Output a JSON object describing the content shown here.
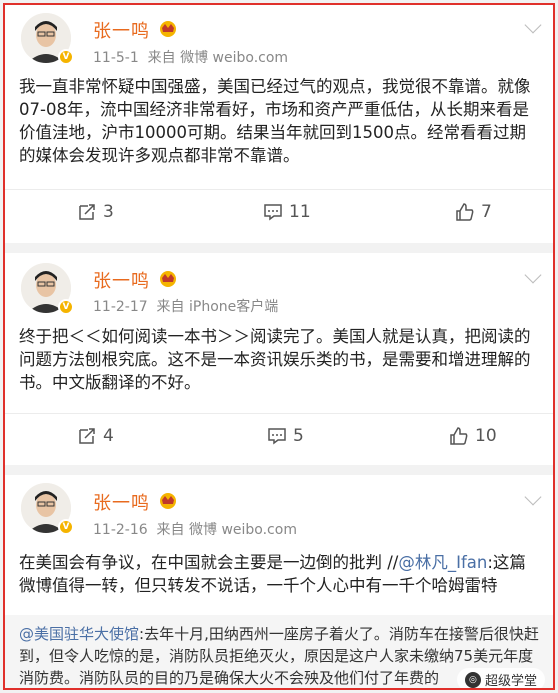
{
  "posts": [
    {
      "author": "张一鸣",
      "date": "11-5-1",
      "source": "来自 微博 weibo.com",
      "text": "我一直非常怀疑中国强盛，美国已经过气的观点，我觉很不靠谱。就像07-08年，流中国经济非常看好，市场和资产严重低估，从长期来看是价值洼地，沪市10000可期。结果当年就回到1500点。经常看看过期的媒体会发现许多观点都非常不靠谱。",
      "reposts": "3",
      "comments": "11",
      "likes": "7"
    },
    {
      "author": "张一鸣",
      "date": "11-2-17",
      "source": "来自 iPhone客户端",
      "text": "终于把＜＜如何阅读一本书＞＞阅读完了。美国人就是认真，把阅读的问题方法刨根究底。这不是一本资讯娱乐类的书，是需要和增进理解的书。中文版翻译的不好。",
      "reposts": "4",
      "comments": "5",
      "likes": "10"
    },
    {
      "author": "张一鸣",
      "date": "11-2-16",
      "source": "来自 微博 weibo.com",
      "text_before": "在美国会有争议，在中国就会主要是一边倒的批判 //",
      "mention": "@林凡_Ifan",
      "text_after": ":这篇微博值得一转，但只转发不说话，一千个人心中有一千个哈姆雷特",
      "repost_mention": "@美国驻华大使馆",
      "repost_text": ":去年十月,田纳西州一座房子着火了。消防车在接警后很快赶到，但令人吃惊的是，消防队员拒绝灭火，原因是这户人家未缴纳75美元年度消防费。消防队员的目的乃是确保大火不会殃及他们付了年费的"
    }
  ],
  "watermark": "超级学堂",
  "colors": {
    "frame": "#e0302b",
    "name": "#e86a1e",
    "mention": "#4a6fa5",
    "badge": "#f5b400"
  },
  "icons": [
    "repost-icon",
    "comment-icon",
    "like-icon",
    "chevron-down-icon",
    "verified-badge-icon",
    "crown-icon"
  ]
}
